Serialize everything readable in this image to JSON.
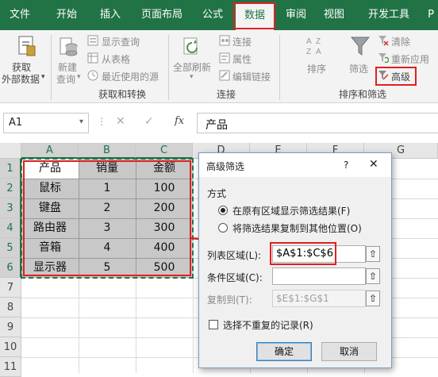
{
  "tabs": [
    "文件",
    "开始",
    "插入",
    "页面布局",
    "公式",
    "数据",
    "审阅",
    "视图",
    "开发工具",
    "P"
  ],
  "active_tab": "数据",
  "ribbon": {
    "get_external_data": [
      "获取",
      "外部数据"
    ],
    "new_query": [
      "新建",
      "查询"
    ],
    "show_queries": "显示查询",
    "from_table": "从表格",
    "recent_sources": "最近使用的源",
    "group_get_transform": "获取和转换",
    "refresh_all": [
      "全部刷新"
    ],
    "connections": "连接",
    "properties": "属性",
    "edit_links": "编辑链接",
    "group_connections": "连接",
    "sort": "排序",
    "filter": "筛选",
    "clear": "清除",
    "reapply": "重新应用",
    "advanced": "高级",
    "group_sort_filter": "排序和筛选"
  },
  "formula_bar": {
    "name_box": "A1",
    "fx": "fx",
    "content": "产品"
  },
  "sheet": {
    "columns": [
      "A",
      "B",
      "C",
      "D",
      "E",
      "F",
      "G"
    ],
    "rows": [
      "1",
      "2",
      "3",
      "4",
      "5",
      "6",
      "7",
      "8",
      "9",
      "10",
      "11"
    ],
    "table": [
      [
        "产品",
        "销量",
        "金额"
      ],
      [
        "鼠标",
        "1",
        "100"
      ],
      [
        "键盘",
        "2",
        "200"
      ],
      [
        "路由器",
        "3",
        "300"
      ],
      [
        "音箱",
        "4",
        "400"
      ],
      [
        "显示器",
        "5",
        "500"
      ]
    ]
  },
  "dialog": {
    "title": "高级筛选",
    "help": "?",
    "method_label": "方式",
    "option_in_place": "在原有区域显示筛选结果(F)",
    "option_copy": "将筛选结果复制到其他位置(O)",
    "list_range_label": "列表区域(L):",
    "list_range_value": "$A$1:$C$6",
    "criteria_label": "条件区域(C):",
    "criteria_value": "",
    "copy_to_label": "复制到(T):",
    "copy_to_value": "$E$1:$G$1",
    "unique_label": "选择不重复的记录(R)",
    "ok": "确定",
    "cancel": "取消"
  },
  "colors": {
    "excel_green": "#217346",
    "highlight_red": "#e02020",
    "range_fill": "#c8c8c8"
  }
}
